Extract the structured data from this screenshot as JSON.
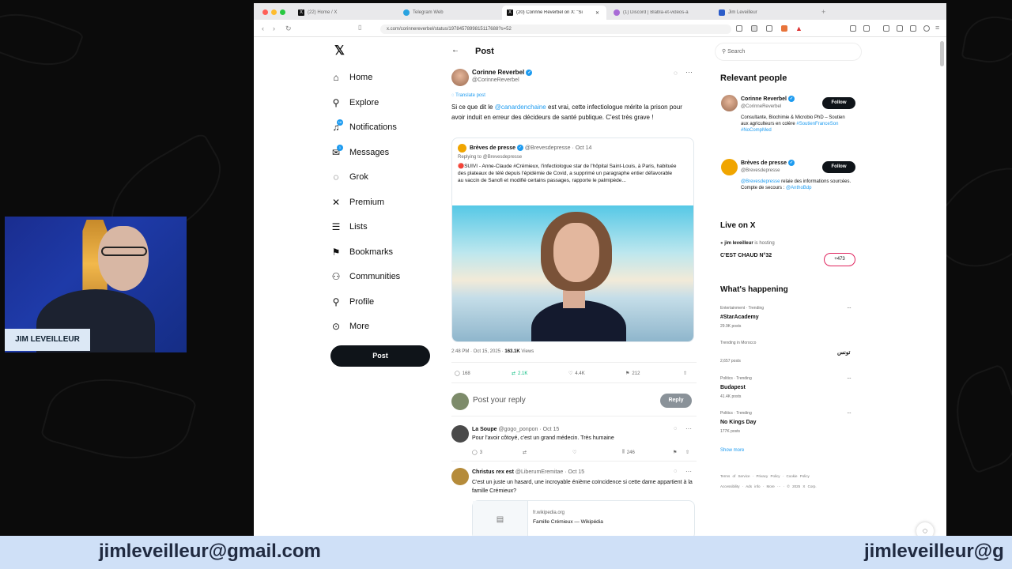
{
  "browser": {
    "tabs": [
      {
        "label": "(22) Home / X",
        "icon": "x-logo-icon"
      },
      {
        "label": "Telegram Web",
        "icon": "telegram-icon"
      },
      {
        "label": "(20) Corinne Reverbel on X: \"Si",
        "icon": "x-logo-icon"
      },
      {
        "label": "(1) Discord | Blabla-et-vidéos-a",
        "icon": "discord-icon"
      },
      {
        "label": "Jim Leveilleur",
        "icon": "w-icon"
      }
    ],
    "url": "x.com/corinnereverbel/status/1978457899815117688?s=52"
  },
  "nav": {
    "items": [
      {
        "label": "Home",
        "icon": "home-icon"
      },
      {
        "label": "Explore",
        "icon": "search-icon"
      },
      {
        "label": "Notifications",
        "icon": "bell-icon",
        "badge": "16"
      },
      {
        "label": "Messages",
        "icon": "mail-icon",
        "badge": "1"
      },
      {
        "label": "Grok",
        "icon": "grok-icon"
      },
      {
        "label": "Premium",
        "icon": "x-logo-icon"
      },
      {
        "label": "Lists",
        "icon": "list-icon"
      },
      {
        "label": "Bookmarks",
        "icon": "bookmark-icon"
      },
      {
        "label": "Communities",
        "icon": "people-icon"
      },
      {
        "label": "Profile",
        "icon": "person-icon"
      },
      {
        "label": "More",
        "icon": "more-circle-icon"
      }
    ],
    "post_label": "Post"
  },
  "post": {
    "header_title": "Post",
    "author_name": "Corinne Reverbel",
    "author_handle": "@CorinneReverbel",
    "translate": "Translate post",
    "text_before": "Si ce que dit le ",
    "mention": "@canardenchaine",
    "text_after": " est vrai, cette infectiologue mérite la prison pour avoir induit en erreur des décideurs de santé publique. C'est très grave !",
    "quote": {
      "author": "Brèves de presse",
      "handle": "@Brevesdepresse",
      "date": "· Oct 14",
      "replying": "Replying to @Brevesdepresse",
      "text": "🔴SUIVI - Anne-Claude #Crémieux, l'infectiologue star de l'hôpital Saint-Louis, à Paris, habituée des plateaux de télé depuis l'épidémie de Covid, a supprimé un paragraphe entier défavorable au vaccin de Sanofi et modifié certains passages, rapporte le palmipède..."
    },
    "meta_time": "2:48 PM · Oct 15, 2025 · ",
    "meta_views": "163.1K",
    "meta_views_label": " Views",
    "actions": {
      "replies": "168",
      "reposts": "2.1K",
      "likes": "4.4K",
      "bookmarks": "212"
    },
    "reply_placeholder": "Post your reply",
    "reply_button": "Reply"
  },
  "replies": [
    {
      "name": "La Soupe",
      "handle": "@gogo_ponpon · Oct 15",
      "text": "Pour l'avoir côtoyé, c'est un grand médecin. Très humaine",
      "replies": "3",
      "views": "246"
    },
    {
      "name": "Christus rex est",
      "handle": "@LiberumEremitae · Oct 15",
      "text": "C'est un juste un hasard, une incroyable énième coïncidence si cette dame appartient à la famille Crémieux?",
      "link_domain": "fr.wikipedia.org",
      "link_title": "Famille Crémieux — Wikipédia"
    }
  ],
  "right": {
    "search_placeholder": "Search",
    "relevant_title": "Relevant people",
    "people": [
      {
        "name": "Corinne Reverbel",
        "handle": "@CorinneReverbel",
        "bio": "Consultante, Biochimie & Microbio PhD – Soutien aux agriculteurs en colère ",
        "tags": "#SoutienFranceSon #NoCompMed",
        "follow": "Follow"
      },
      {
        "name": "Brèves de presse",
        "handle": "@Brevesdepresse",
        "bio_link": "@Brevesdepresse",
        "bio": " relaie des informations sourcées. Compte de secours : ",
        "bio_link2": "@AnthoBdp",
        "follow": "Follow"
      }
    ],
    "live_title": "Live on X",
    "live_host": "jim leveilleur",
    "live_hosting": " is hosting",
    "live_title_text": "C'EST CHAUD N°32",
    "live_count": "+473",
    "happening_title": "What's happening",
    "trends": [
      {
        "category": "Entertainment · Trending",
        "name": "#StarAcademy",
        "count": "29.9K posts"
      },
      {
        "category": "Trending in Morocco",
        "name": "تونس",
        "count": "2,657 posts"
      },
      {
        "category": "Politics · Trending",
        "name": "Budapest",
        "count": "41.4K posts"
      },
      {
        "category": "Politics · Trending",
        "name": "No Kings Day",
        "count": "177K posts"
      }
    ],
    "show_more": "Show more",
    "footer_links": [
      "Terms of Service",
      "Privacy Policy",
      "Cookie Policy",
      "Accessibility",
      "Ads info",
      "More ···",
      "© 2025 X Corp."
    ]
  },
  "webcam": {
    "name": "JIM LEVEILLEUR"
  },
  "banner": {
    "email": "jimleveilleur@gmail.com",
    "email_repeat": "jimleveilleur@g"
  },
  "colors": {
    "accent": "#1d9bf0",
    "dark": "#0f1419",
    "banner": "#cfe0f7"
  }
}
